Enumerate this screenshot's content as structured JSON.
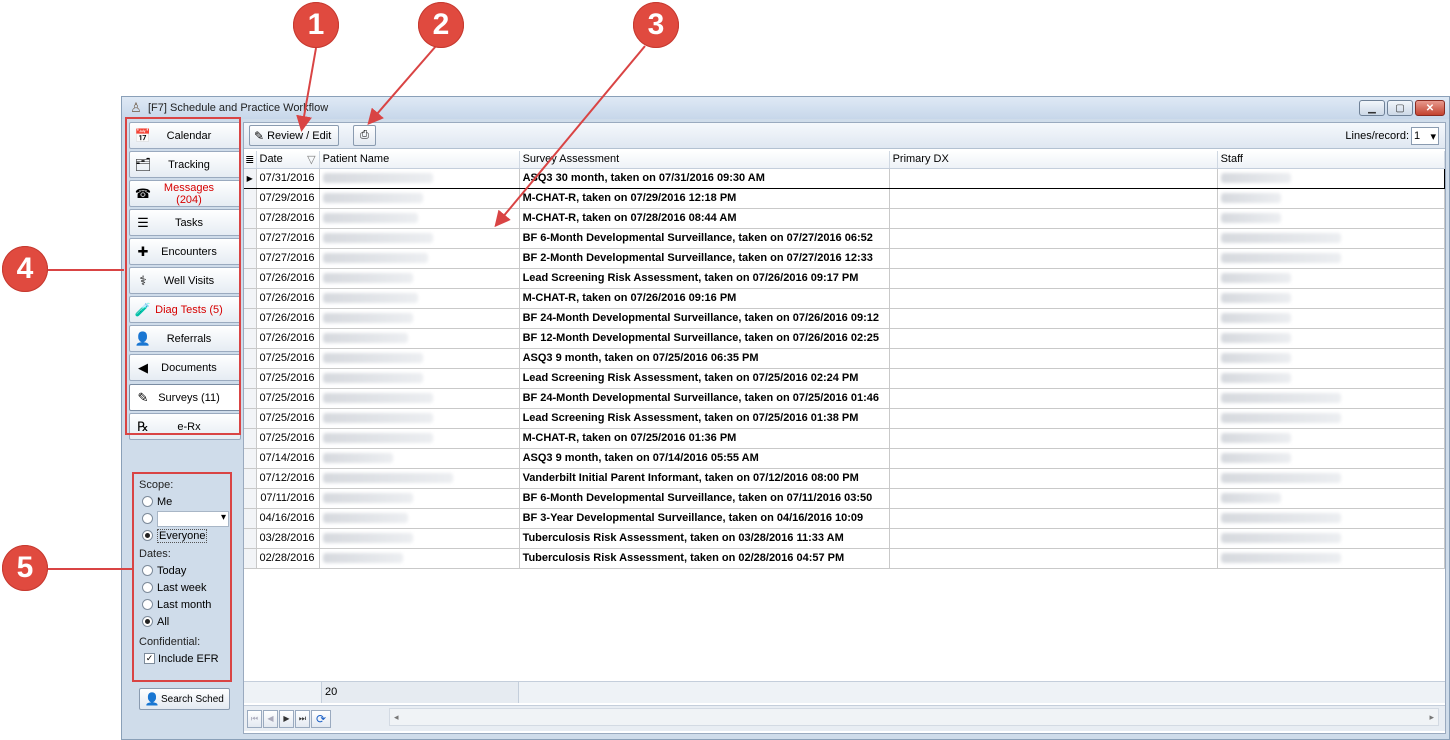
{
  "window": {
    "title": "[F7] Schedule and Practice Workflow"
  },
  "nav": {
    "items": [
      {
        "label": "Calendar",
        "icon": "calendar-icon",
        "glyph": "📅",
        "red": false
      },
      {
        "label": "Tracking",
        "icon": "tracking-icon",
        "glyph": "🗂",
        "red": false
      },
      {
        "label": "Messages (204)",
        "icon": "phone-icon",
        "glyph": "☎",
        "red": true
      },
      {
        "label": "Tasks",
        "icon": "tasks-icon",
        "glyph": "☰",
        "red": false
      },
      {
        "label": "Encounters",
        "icon": "encounter-icon",
        "glyph": "✚",
        "red": false
      },
      {
        "label": "Well Visits",
        "icon": "stethoscope-icon",
        "glyph": "⚕",
        "red": false
      },
      {
        "label": "Diag Tests (5)",
        "icon": "test-tubes-icon",
        "glyph": "🧪",
        "red": true
      },
      {
        "label": "Referrals",
        "icon": "referral-icon",
        "glyph": "👤",
        "red": false
      },
      {
        "label": "Documents",
        "icon": "documents-icon",
        "glyph": "◀",
        "red": false
      },
      {
        "label": "Surveys (11)",
        "icon": "survey-icon",
        "glyph": "✎",
        "red": false,
        "selected": true
      },
      {
        "label": "e-Rx",
        "icon": "rx-icon",
        "glyph": "℞",
        "red": false
      }
    ]
  },
  "filters": {
    "scope_label": "Scope:",
    "scope_me": "Me",
    "scope_everyone": "Everyone",
    "dates_label": "Dates:",
    "dates_today": "Today",
    "dates_last_week": "Last week",
    "dates_last_month": "Last month",
    "dates_all": "All",
    "confidential_label": "Confidential:",
    "include_efr": "Include EFR",
    "search_sched": "Search Sched"
  },
  "toolbar": {
    "review_edit": "Review / Edit",
    "lines_label": "Lines/record:",
    "lines_value": "1"
  },
  "grid": {
    "columns": [
      "Date",
      "Patient Name",
      "Survey Assessment",
      "Primary DX",
      "Staff"
    ],
    "rows": [
      {
        "date": "07/31/2016",
        "survey": "ASQ3 30 month, taken on 07/31/2016 09:30 AM"
      },
      {
        "date": "07/29/2016",
        "survey": "M-CHAT-R, taken on 07/29/2016 12:18 PM"
      },
      {
        "date": "07/28/2016",
        "survey": "M-CHAT-R, taken on 07/28/2016 08:44 AM"
      },
      {
        "date": "07/27/2016",
        "survey": "BF 6-Month Developmental Surveillance, taken on 07/27/2016 06:52"
      },
      {
        "date": "07/27/2016",
        "survey": "BF 2-Month Developmental Surveillance, taken on 07/27/2016 12:33"
      },
      {
        "date": "07/26/2016",
        "survey": "Lead Screening Risk Assessment, taken on 07/26/2016 09:17 PM"
      },
      {
        "date": "07/26/2016",
        "survey": "M-CHAT-R, taken on 07/26/2016 09:16 PM"
      },
      {
        "date": "07/26/2016",
        "survey": "BF 24-Month Developmental Surveillance, taken on 07/26/2016 09:12"
      },
      {
        "date": "07/26/2016",
        "survey": "BF 12-Month Developmental Surveillance, taken on 07/26/2016 02:25"
      },
      {
        "date": "07/25/2016",
        "survey": "ASQ3 9 month, taken on 07/25/2016 06:35 PM"
      },
      {
        "date": "07/25/2016",
        "survey": "Lead Screening Risk Assessment, taken on 07/25/2016 02:24 PM"
      },
      {
        "date": "07/25/2016",
        "survey": "BF 24-Month Developmental Surveillance, taken on 07/25/2016 01:46"
      },
      {
        "date": "07/25/2016",
        "survey": "Lead Screening Risk Assessment, taken on 07/25/2016 01:38 PM"
      },
      {
        "date": "07/25/2016",
        "survey": "M-CHAT-R, taken on 07/25/2016 01:36 PM"
      },
      {
        "date": "07/14/2016",
        "survey": "ASQ3 9 month, taken on 07/14/2016 05:55 AM"
      },
      {
        "date": "07/12/2016",
        "survey": "Vanderbilt Initial Parent Informant, taken on 07/12/2016 08:00 PM"
      },
      {
        "date": "07/11/2016",
        "survey": "BF 6-Month Developmental Surveillance, taken on 07/11/2016 03:50"
      },
      {
        "date": "04/16/2016",
        "survey": "BF 3-Year Developmental Surveillance, taken on 04/16/2016 10:09"
      },
      {
        "date": "03/28/2016",
        "survey": "Tuberculosis Risk Assessment, taken on 03/28/2016 11:33 AM"
      },
      {
        "date": "02/28/2016",
        "survey": "Tuberculosis Risk Assessment, taken on 02/28/2016 04:57 PM"
      }
    ],
    "record_count": "20"
  },
  "callouts": [
    "1",
    "2",
    "3",
    "4",
    "5"
  ]
}
